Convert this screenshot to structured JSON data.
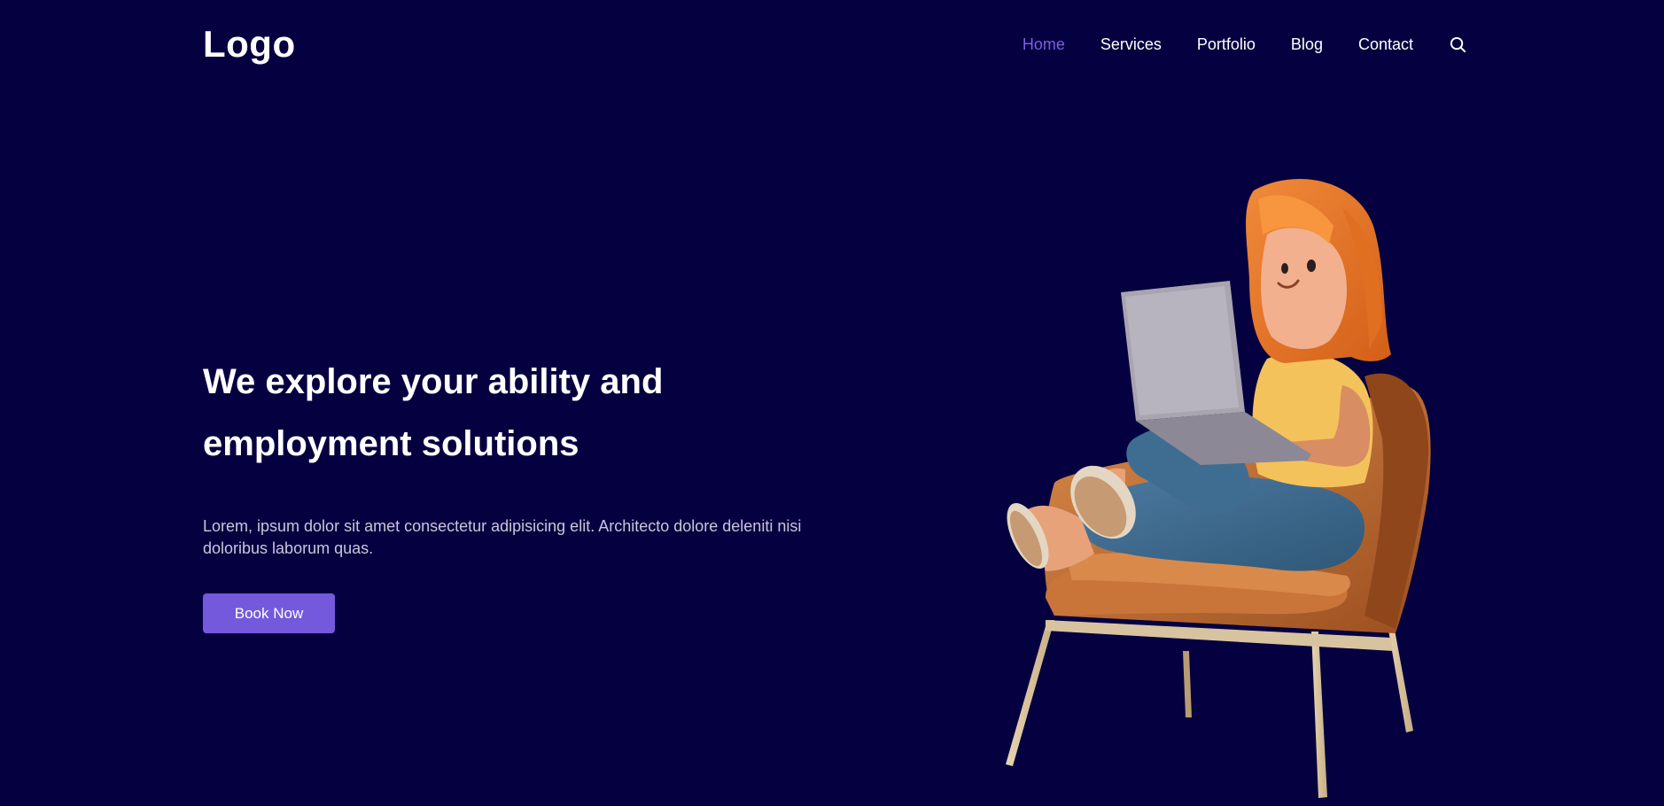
{
  "header": {
    "logo": "Logo",
    "nav": [
      {
        "label": "Home",
        "active": true
      },
      {
        "label": "Services",
        "active": false
      },
      {
        "label": "Portfolio",
        "active": false
      },
      {
        "label": "Blog",
        "active": false
      },
      {
        "label": "Contact",
        "active": false
      }
    ],
    "search_icon": "search-icon"
  },
  "hero": {
    "title": "We explore your ability and employment solutions",
    "description": "Lorem, ipsum dolor sit amet consectetur adipisicing elit. Architecto dolore deleniti nisi doloribus laborum quas.",
    "cta_label": "Book Now"
  },
  "colors": {
    "background": "#050040",
    "accent": "#7459dc",
    "nav_active": "#7b5fe0",
    "text": "#ffffff"
  }
}
